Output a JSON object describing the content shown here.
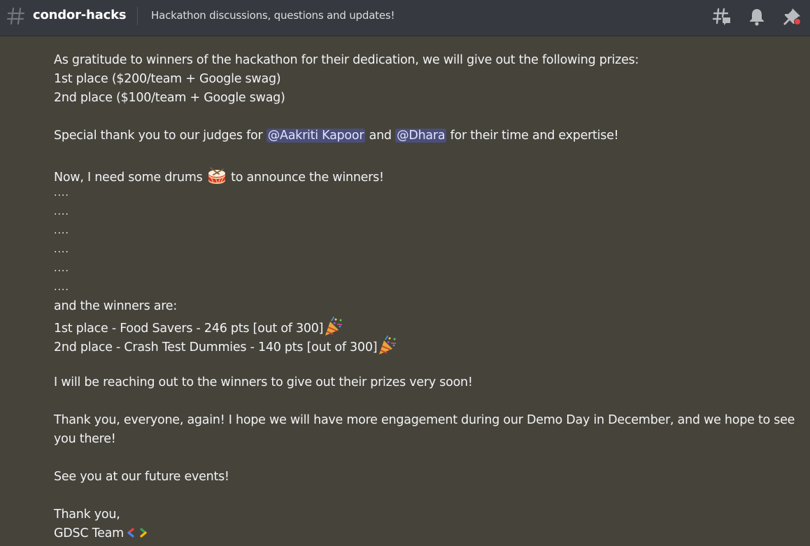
{
  "header": {
    "channel_name": "condor-hacks",
    "topic": "Hackathon discussions, questions and updates!",
    "icons": [
      "hash-icon",
      "threads-icon",
      "bell-icon",
      "pin-icon"
    ]
  },
  "message": {
    "intro": "As gratitude to winners of the hackathon for their dedication, we will give out the following prizes:",
    "prize_1": "1st place ($200/team + Google swag)",
    "prize_2": "2nd place ($100/team + Google swag)",
    "thanks_pre": "Special thank you to our judges for ",
    "mention_1": "@Aakriti Kapoor",
    "thanks_and": " and ",
    "mention_2": "@Dhara",
    "thanks_post": " for their time and expertise!",
    "drums_pre": "Now, I need some drums ",
    "drums_post": " to announce the winners!",
    "dots": [
      "....",
      "....",
      "....",
      "....",
      "....",
      "...."
    ],
    "winners_intro": "and the winners are:",
    "winner_1": "1st place - Food Savers - 246 pts [out of 300]",
    "winner_2": "2nd place - Crash Test Dummies - 140 pts [out of 300]",
    "reach_out": "I will be reaching out to the winners to give out their prizes very soon!",
    "thank_everyone": "Thank you, everyone, again! I hope we will have more engagement during our Demo Day in December, and we hope to see you there!",
    "see_you": "See you at our future events!",
    "sign_off": "Thank you,",
    "signature": "GDSC Team"
  },
  "colors": {
    "background": "#46433b",
    "header_background": "#36393f",
    "mention_background": "#4b4f8a",
    "notification_dot": "#ed4245"
  }
}
